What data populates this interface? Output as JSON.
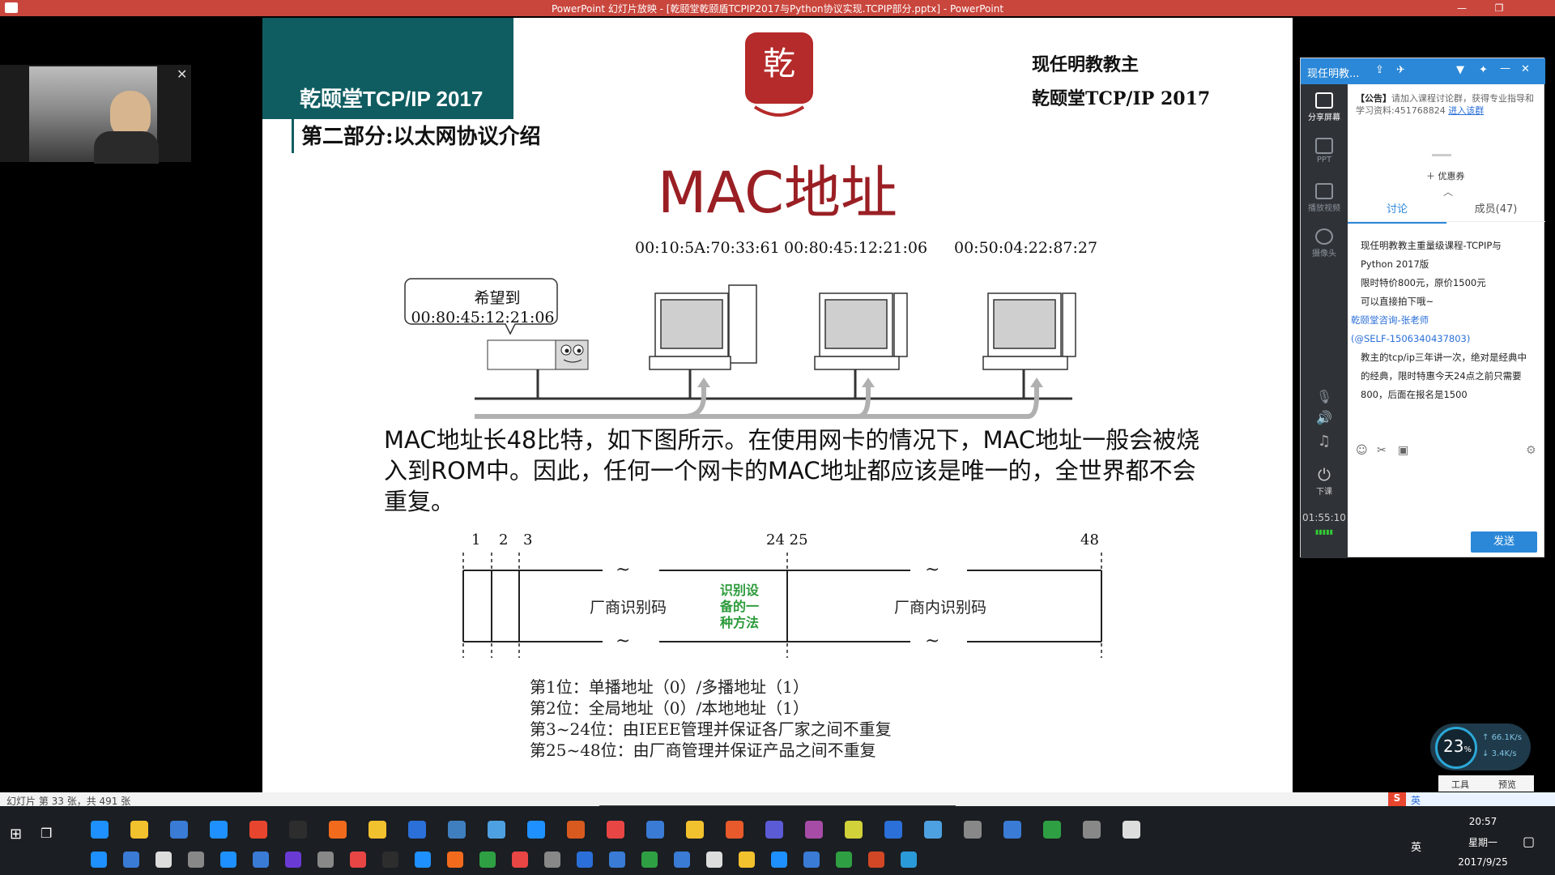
{
  "window": {
    "title": "PowerPoint 幻灯片放映 - [乾颐堂乾颐盾TCPIP2017与Python协议实现.TCPIP部分.pptx] - PowerPoint",
    "minimize": "—",
    "restore": "❐"
  },
  "slide": {
    "header_title": "乾颐堂TCP/IP 2017",
    "header_subtitle": "第二部分:以太网协议介绍",
    "logo_chars": "乾颐堂",
    "right_line1": "现任明教教主",
    "right_line2": "乾颐堂TCP/IP 2017",
    "heading": "MAC地址",
    "mac_addrs": [
      "00:10:5A:70:33:61",
      "00:80:45:12:21:06",
      "00:50:04:22:87:27"
    ],
    "bubble_line1": "希望到",
    "bubble_line2": "00:80:45:12:21:06",
    "body_text": "MAC地址长48比特，如下图所示。在使用网卡的情况下，MAC地址一般会被烧入到ROM中。因此，任何一个网卡的MAC地址都应该是唯一的，全世界都不会重复。",
    "bit_labels": [
      "1",
      "2",
      "3",
      "24 25",
      "48"
    ],
    "field_vendor": "厂商识别码",
    "field_device": "厂商内识别码",
    "field_note": "识别设备的一种方法",
    "field_note_lines": [
      "识别设",
      "备的一",
      "种方法"
    ],
    "legend": [
      "第1位：单播地址（0）/多播地址（1）",
      "第2位：全局地址（0）/本地地址（1）",
      "第3~24位：由IEEE管理并保证各厂家之间不重复",
      "第25~48位：由厂商管理并保证产品之间不重复"
    ]
  },
  "statusbar": {
    "slide_counter": "幻灯片 第 33 张，共 491 张"
  },
  "chat_panel": {
    "title": "现任明教...",
    "sidebar": [
      "分享屏幕",
      "PPT",
      "播放视频",
      "摄像头"
    ],
    "notice_tag": "【公告】",
    "notice_text": "请加入课程讨论群，获得专业指导和学习资料:451768824",
    "notice_link": "进入该群",
    "coupon": "＋ 优惠券",
    "tabs": [
      "讨论",
      "成员(47)"
    ],
    "messages": [
      "现任明教教主重量级课程-TCPIP与Python 2017版",
      "限时特价800元，原价1500元",
      "可以直接拍下哦~",
      "乾颐堂咨询-张老师",
      "(@SELF-1506340437803)",
      "教主的tcp/ip三年讲一次，绝对是经典中的经典，限时特惠今天24点之前只需要800，后面在报名是1500"
    ],
    "leave_label": "下课",
    "timer": "01:55:10",
    "send_button": "发送"
  },
  "net_widget": {
    "percent": "23",
    "up": "66.1K/s",
    "down": "3.4K/s",
    "unit": "%"
  },
  "tray": {
    "time": "20:57",
    "weekday": "星期一",
    "date": "2017/9/25",
    "ime": "英"
  },
  "preview_tabs": [
    "工具",
    "预览"
  ]
}
